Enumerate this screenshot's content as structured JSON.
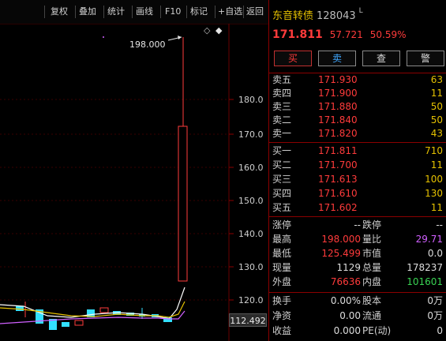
{
  "toolbar": {
    "items": [
      "复权",
      "叠加",
      "统计",
      "画线",
      "F10",
      "标记",
      "+自选",
      "返回"
    ]
  },
  "chart": {
    "peak_label": "198.000",
    "price_axis": [
      "180.0",
      "170.0",
      "160.0",
      "150.0",
      "140.0",
      "130.0",
      "120.0"
    ],
    "current_price_tag": "112.492",
    "icons": [
      "diamond-icon",
      "hollow-diamond-icon"
    ],
    "colors": {
      "up": "#ff3b3b",
      "down": "#33e0ff",
      "ma5": "#ffffff",
      "ma10": "#e5c100",
      "ma20": "#d060ff"
    }
  },
  "stock": {
    "name": "东音转债",
    "code": "128043",
    "flag": "L",
    "last_price": "171.811",
    "change": "57.721",
    "change_pct": "50.59%"
  },
  "actions": {
    "buy": "买",
    "sell": "卖",
    "check": "查",
    "warn": "警"
  },
  "order_book": {
    "asks": [
      {
        "label": "卖五",
        "price": "171.930",
        "volume": "63"
      },
      {
        "label": "卖四",
        "price": "171.900",
        "volume": "11"
      },
      {
        "label": "卖三",
        "price": "171.880",
        "volume": "50"
      },
      {
        "label": "卖二",
        "price": "171.840",
        "volume": "50"
      },
      {
        "label": "卖一",
        "price": "171.820",
        "volume": "43"
      }
    ],
    "bids": [
      {
        "label": "买一",
        "price": "171.811",
        "volume": "710"
      },
      {
        "label": "买二",
        "price": "171.700",
        "volume": "11"
      },
      {
        "label": "买三",
        "price": "171.613",
        "volume": "100"
      },
      {
        "label": "买四",
        "price": "171.610",
        "volume": "130"
      },
      {
        "label": "买五",
        "price": "171.602",
        "volume": "11"
      }
    ]
  },
  "stats": {
    "group1": [
      {
        "l1": "涨停",
        "v1": "--",
        "l2": "跌停",
        "v2": "--"
      },
      {
        "l1": "最高",
        "v1": "198.000",
        "l2": "量比",
        "v2": "29.71"
      },
      {
        "l1": "最低",
        "v1": "125.499",
        "l2": "市值",
        "v2": "0.0"
      },
      {
        "l1": "现量",
        "v1": "1129",
        "l2": "总量",
        "v2": "178237"
      },
      {
        "l1": "外盘",
        "v1": "76636",
        "l2": "内盘",
        "v2": "101601"
      }
    ],
    "group2": [
      {
        "l1": "换手",
        "v1": "0.00%",
        "l2": "股本",
        "v2": "0万"
      },
      {
        "l1": "净资",
        "v1": "0.00",
        "l2": "流通",
        "v2": "0万"
      },
      {
        "l1": "收益",
        "v1": "0.000",
        "l2": "PE(动)",
        "v2": "0"
      }
    ]
  }
}
